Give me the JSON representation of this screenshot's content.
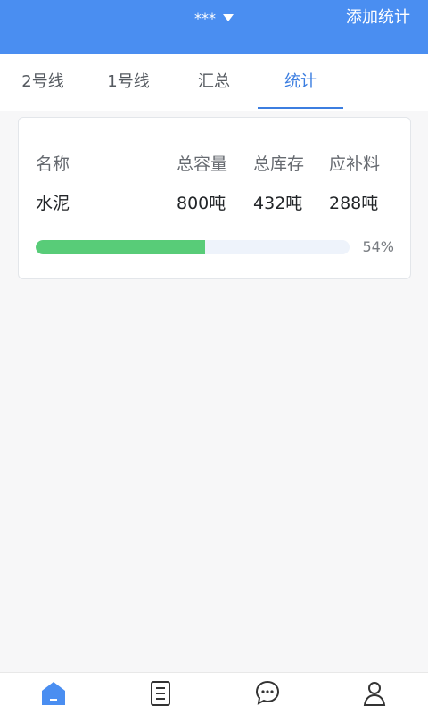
{
  "header": {
    "title": "***",
    "add_label": "添加统计",
    "bg_color": "#4a8ef1"
  },
  "tabs": [
    {
      "label": "2号线",
      "active": false
    },
    {
      "label": "1号线",
      "active": false
    },
    {
      "label": "汇总",
      "active": false
    },
    {
      "label": "统计",
      "active": true
    }
  ],
  "card": {
    "headers": [
      "名称",
      "总容量",
      "总库存",
      "应补料"
    ],
    "rows": [
      {
        "name": "水泥",
        "capacity": "800吨",
        "stock": "432吨",
        "replenish": "288吨",
        "progress_fraction": 0.54,
        "progress_label": "54%"
      }
    ]
  },
  "bottom_nav": {
    "items": [
      {
        "icon": "home-icon",
        "active": true
      },
      {
        "icon": "document-list-icon",
        "active": false
      },
      {
        "icon": "message-icon",
        "active": false
      },
      {
        "icon": "user-icon",
        "active": false
      }
    ]
  },
  "colors": {
    "accent": "#3c7ee0",
    "progress": "#58cc78",
    "progress_track": "#eef3fb"
  }
}
